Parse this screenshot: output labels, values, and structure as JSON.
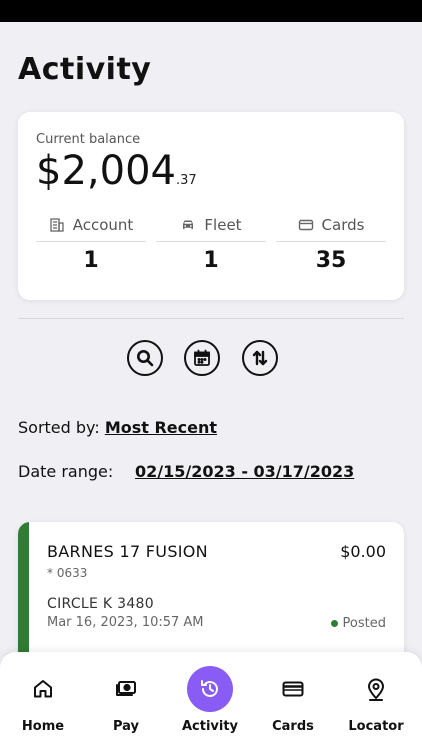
{
  "header": {
    "title": "Activity"
  },
  "balance": {
    "label": "Current balance",
    "amount_main": "$2,004",
    "amount_cents": ".37",
    "stats": [
      {
        "label": "Account",
        "value": "1",
        "icon": "building-icon"
      },
      {
        "label": "Fleet",
        "value": "1",
        "icon": "car-icon"
      },
      {
        "label": "Cards",
        "value": "35",
        "icon": "card-icon"
      }
    ]
  },
  "toolbar": {
    "icons": [
      "search-icon",
      "calendar-icon",
      "sort-icon"
    ]
  },
  "sort": {
    "label": "Sorted by:",
    "value": "Most Recent"
  },
  "date_range": {
    "label": "Date range:",
    "value": "02/15/2023 - 03/17/2023"
  },
  "transactions": [
    {
      "merchant": "BARNES 17 FUSION",
      "card": "* 0633",
      "amount": "$0.00",
      "location": "CIRCLE K 3480",
      "datetime": "Mar 16, 2023, 10:57 AM",
      "status": "Posted",
      "status_color": "#2e7d32"
    }
  ],
  "tabs": [
    {
      "label": "Home",
      "icon": "home-icon",
      "active": false
    },
    {
      "label": "Pay",
      "icon": "cash-icon",
      "active": false
    },
    {
      "label": "Activity",
      "icon": "history-icon",
      "active": true
    },
    {
      "label": "Cards",
      "icon": "cards-icon",
      "active": false
    },
    {
      "label": "Locator",
      "icon": "location-pin-icon",
      "active": false
    }
  ],
  "colors": {
    "accent": "#8a5cf6",
    "posted": "#2e7d32",
    "background": "#efeff4"
  }
}
